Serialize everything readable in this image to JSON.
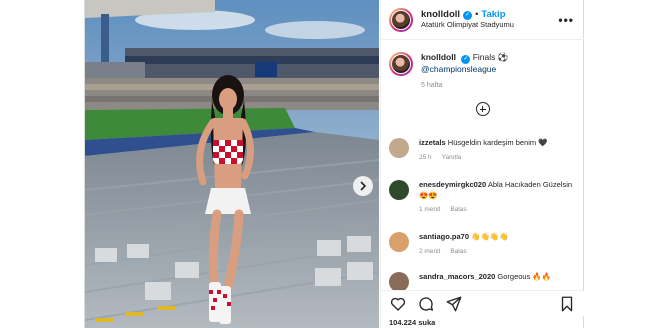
{
  "header": {
    "username": "knolldoll",
    "separator": "•",
    "follow_label": "Takip",
    "location": "Atatürk Olimpiyat Stadyumu",
    "more_label": "•••"
  },
  "caption": {
    "username": "knolldoll",
    "text": "Finals ⚽",
    "mention": "@championsleague",
    "time": "5 hafta"
  },
  "comments": [
    {
      "username": "izzetals",
      "text": "Hüsgeldin kardeşim benim",
      "meta": [
        "25 h",
        "Yanıtla"
      ],
      "emoji": "🖤",
      "avatar_color": "#c2a88d"
    },
    {
      "username": "enesdeymirgkc020",
      "text": "Abla Hacıkaden Güzelsin 😍😍",
      "meta": [
        "1 menit",
        "Balas"
      ],
      "emoji": "",
      "avatar_color": "#2f4a2a"
    },
    {
      "username": "santiago.pa70",
      "text": "👋👋👋👋",
      "meta": [
        "2 menit",
        "Balas"
      ],
      "emoji": "",
      "avatar_color": "#d8a06a"
    },
    {
      "username": "sandra_macors_2020",
      "text": "Gorgeous 🔥🔥",
      "meta": [],
      "emoji": "",
      "avatar_color": "#8a6b5a"
    }
  ],
  "likes_text": "104.224 suka",
  "icons": {
    "like": "heart-icon",
    "comment": "comment-icon",
    "share": "send-icon",
    "save": "bookmark-icon",
    "load_more": "plus-circle-icon",
    "next": "chevron-right-icon"
  },
  "colors": {
    "accent": "#0095f6",
    "verified": "#0095f6",
    "mention": "#00376b"
  }
}
